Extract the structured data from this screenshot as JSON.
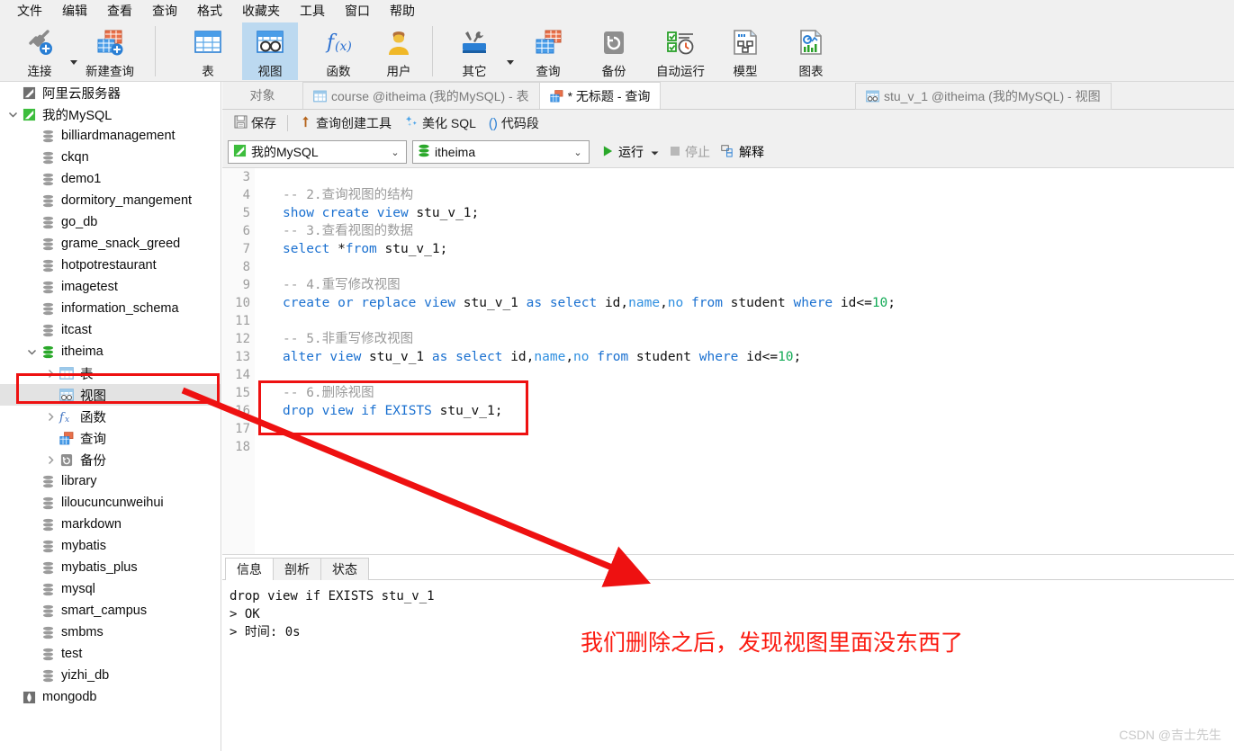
{
  "menubar": {
    "items": [
      {
        "label": "文件"
      },
      {
        "label": "编辑"
      },
      {
        "label": "查看"
      },
      {
        "label": "查询"
      },
      {
        "label": "格式"
      },
      {
        "label": "收藏夹"
      },
      {
        "label": "工具"
      },
      {
        "label": "窗口"
      },
      {
        "label": "帮助"
      }
    ]
  },
  "ribbon": {
    "buttons": [
      {
        "label": "连接",
        "icon": "connection-icon"
      },
      {
        "label": "新建查询",
        "icon": "new-query-icon"
      },
      {
        "label": "表",
        "icon": "table-icon"
      },
      {
        "label": "视图",
        "icon": "view-icon"
      },
      {
        "label": "函数",
        "icon": "function-icon"
      },
      {
        "label": "用户",
        "icon": "user-icon"
      },
      {
        "label": "其它",
        "icon": "other-tools-icon"
      },
      {
        "label": "查询",
        "icon": "query-icon"
      },
      {
        "label": "备份",
        "icon": "backup-icon"
      },
      {
        "label": "自动运行",
        "icon": "automation-icon"
      },
      {
        "label": "模型",
        "icon": "model-icon"
      },
      {
        "label": "图表",
        "icon": "chart-icon"
      }
    ],
    "active_label": "视图"
  },
  "sidebar": {
    "items": [
      {
        "label": "阿里云服务器",
        "icon": "navicat-connection-icon",
        "indent": 0,
        "arrow": "",
        "selected": false
      },
      {
        "label": "我的MySQL",
        "icon": "navicat-connection-icon",
        "indent": 0,
        "arrow": "expanded",
        "selected": false
      },
      {
        "label": "billiardmanagement",
        "icon": "database-icon",
        "indent": 1,
        "arrow": "",
        "selected": false
      },
      {
        "label": "ckqn",
        "icon": "database-icon",
        "indent": 1,
        "arrow": "",
        "selected": false
      },
      {
        "label": "demo1",
        "icon": "database-icon",
        "indent": 1,
        "arrow": "",
        "selected": false
      },
      {
        "label": "dormitory_mangement",
        "icon": "database-icon",
        "indent": 1,
        "arrow": "",
        "selected": false
      },
      {
        "label": "go_db",
        "icon": "database-icon",
        "indent": 1,
        "arrow": "",
        "selected": false
      },
      {
        "label": "grame_snack_greed",
        "icon": "database-icon",
        "indent": 1,
        "arrow": "",
        "selected": false
      },
      {
        "label": "hotpotrestaurant",
        "icon": "database-icon",
        "indent": 1,
        "arrow": "",
        "selected": false
      },
      {
        "label": "imagetest",
        "icon": "database-icon",
        "indent": 1,
        "arrow": "",
        "selected": false
      },
      {
        "label": "information_schema",
        "icon": "database-icon",
        "indent": 1,
        "arrow": "",
        "selected": false
      },
      {
        "label": "itcast",
        "icon": "database-icon",
        "indent": 1,
        "arrow": "",
        "selected": false
      },
      {
        "label": "itheima",
        "icon": "database-open-icon",
        "indent": 1,
        "arrow": "expanded",
        "selected": false
      },
      {
        "label": "表",
        "icon": "tables-folder-icon",
        "indent": 2,
        "arrow": "collapsed",
        "selected": false
      },
      {
        "label": "视图",
        "icon": "views-folder-icon",
        "indent": 2,
        "arrow": "",
        "selected": true
      },
      {
        "label": "函数",
        "icon": "functions-folder-icon",
        "indent": 2,
        "arrow": "collapsed",
        "selected": false
      },
      {
        "label": "查询",
        "icon": "queries-folder-icon",
        "indent": 2,
        "arrow": "",
        "selected": false
      },
      {
        "label": "备份",
        "icon": "backups-folder-icon",
        "indent": 2,
        "arrow": "collapsed",
        "selected": false
      },
      {
        "label": "library",
        "icon": "database-icon",
        "indent": 1,
        "arrow": "",
        "selected": false
      },
      {
        "label": "liloucuncunweihui",
        "icon": "database-icon",
        "indent": 1,
        "arrow": "",
        "selected": false
      },
      {
        "label": "markdown",
        "icon": "database-icon",
        "indent": 1,
        "arrow": "",
        "selected": false
      },
      {
        "label": "mybatis",
        "icon": "database-icon",
        "indent": 1,
        "arrow": "",
        "selected": false
      },
      {
        "label": "mybatis_plus",
        "icon": "database-icon",
        "indent": 1,
        "arrow": "",
        "selected": false
      },
      {
        "label": "mysql",
        "icon": "database-icon",
        "indent": 1,
        "arrow": "",
        "selected": false
      },
      {
        "label": "smart_campus",
        "icon": "database-icon",
        "indent": 1,
        "arrow": "",
        "selected": false
      },
      {
        "label": "smbms",
        "icon": "database-icon",
        "indent": 1,
        "arrow": "",
        "selected": false
      },
      {
        "label": "test",
        "icon": "database-icon",
        "indent": 1,
        "arrow": "",
        "selected": false
      },
      {
        "label": "yizhi_db",
        "icon": "database-icon",
        "indent": 1,
        "arrow": "",
        "selected": false
      },
      {
        "label": "mongodb",
        "icon": "mongodb-connection-icon",
        "indent": 0,
        "arrow": "",
        "selected": false
      }
    ]
  },
  "tabs": [
    {
      "label": "对象",
      "icon": "",
      "active": false
    },
    {
      "label": "course @itheima (我的MySQL) - 表",
      "icon": "table-icon",
      "active": false
    },
    {
      "label": "* 无标题 - 查询",
      "icon": "query-icon",
      "active": true
    },
    {
      "label": "stu_v_1 @itheima (我的MySQL) - 视图",
      "icon": "view-icon",
      "active": false
    }
  ],
  "query_toolbar": {
    "save": "保存",
    "query_builder": "查询创建工具",
    "beautify_sql": "美化 SQL",
    "code_snippet": "代码段"
  },
  "connection_bar": {
    "connection": "我的MySQL",
    "database": "itheima",
    "run": "运行",
    "stop": "停止",
    "explain": "解释"
  },
  "editor": {
    "first_line_number": 3,
    "lines": [
      {
        "n": 3,
        "tokens": []
      },
      {
        "n": 4,
        "tokens": [
          {
            "t": "-- 2.查询视图的结构",
            "c": "cmt"
          }
        ]
      },
      {
        "n": 5,
        "tokens": [
          {
            "t": "show create view",
            "c": "kw"
          },
          {
            "t": " stu_v_1;",
            "c": "id"
          }
        ]
      },
      {
        "n": 6,
        "tokens": [
          {
            "t": "-- 3.查看视图的数据",
            "c": "cmt"
          }
        ]
      },
      {
        "n": 7,
        "tokens": [
          {
            "t": "select",
            "c": "kw"
          },
          {
            "t": " *",
            "c": "id"
          },
          {
            "t": "from",
            "c": "kw"
          },
          {
            "t": " stu_v_1;",
            "c": "id"
          }
        ]
      },
      {
        "n": 8,
        "tokens": []
      },
      {
        "n": 9,
        "tokens": [
          {
            "t": "-- 4.重写修改视图",
            "c": "cmt"
          }
        ]
      },
      {
        "n": 10,
        "tokens": [
          {
            "t": "create or replace view",
            "c": "kw"
          },
          {
            "t": " stu_v_1 ",
            "c": "id"
          },
          {
            "t": "as select",
            "c": "kw"
          },
          {
            "t": " id,",
            "c": "id"
          },
          {
            "t": "name",
            "c": "pnk"
          },
          {
            "t": ",",
            "c": "id"
          },
          {
            "t": "no",
            "c": "pnk"
          },
          {
            "t": " ",
            "c": "id"
          },
          {
            "t": "from",
            "c": "kw"
          },
          {
            "t": " student ",
            "c": "id"
          },
          {
            "t": "where",
            "c": "kw"
          },
          {
            "t": " id<=",
            "c": "id"
          },
          {
            "t": "10",
            "c": "num"
          },
          {
            "t": ";",
            "c": "id"
          }
        ]
      },
      {
        "n": 11,
        "tokens": []
      },
      {
        "n": 12,
        "tokens": [
          {
            "t": "-- 5.非重写修改视图",
            "c": "cmt"
          }
        ]
      },
      {
        "n": 13,
        "tokens": [
          {
            "t": "alter view",
            "c": "kw"
          },
          {
            "t": " stu_v_1 ",
            "c": "id"
          },
          {
            "t": "as select",
            "c": "kw"
          },
          {
            "t": " id,",
            "c": "id"
          },
          {
            "t": "name",
            "c": "pnk"
          },
          {
            "t": ",",
            "c": "id"
          },
          {
            "t": "no",
            "c": "pnk"
          },
          {
            "t": " ",
            "c": "id"
          },
          {
            "t": "from",
            "c": "kw"
          },
          {
            "t": " student ",
            "c": "id"
          },
          {
            "t": "where",
            "c": "kw"
          },
          {
            "t": " id<=",
            "c": "id"
          },
          {
            "t": "10",
            "c": "num"
          },
          {
            "t": ";",
            "c": "id"
          }
        ]
      },
      {
        "n": 14,
        "tokens": []
      },
      {
        "n": 15,
        "tokens": [
          {
            "t": "-- 6.删除视图",
            "c": "cmt"
          }
        ]
      },
      {
        "n": 16,
        "tokens": [
          {
            "t": "drop view if",
            "c": "kw"
          },
          {
            "t": " ",
            "c": "id"
          },
          {
            "t": "EXISTS",
            "c": "kw"
          },
          {
            "t": " stu_v_1;",
            "c": "id"
          }
        ]
      },
      {
        "n": 17,
        "tokens": []
      },
      {
        "n": 18,
        "tokens": []
      }
    ]
  },
  "results": {
    "tabs": [
      {
        "label": "信息",
        "active": true
      },
      {
        "label": "剖析",
        "active": false
      },
      {
        "label": "状态",
        "active": false
      }
    ],
    "output": [
      "drop view if EXISTS stu_v_1",
      "> OK",
      "> 时间: 0s"
    ]
  },
  "annotations": {
    "note_text": "我们删除之后，发现视图里面没东西了",
    "accent_color": "#ee1111",
    "note_color": "#fb1a10"
  },
  "watermark": "CSDN @吉士先生"
}
